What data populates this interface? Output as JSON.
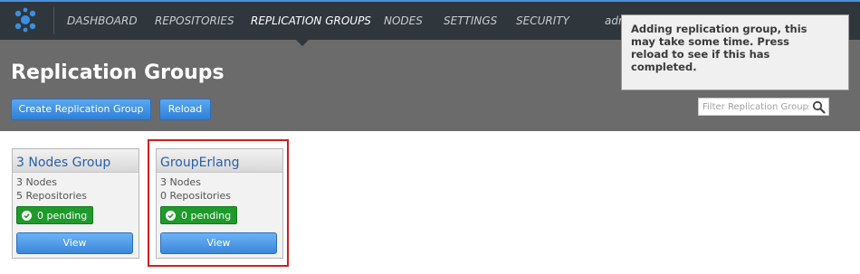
{
  "nav": {
    "items": [
      {
        "label": "DASHBOARD"
      },
      {
        "label": "REPOSITORIES"
      },
      {
        "label": "REPLICATION GROUPS"
      },
      {
        "label": "NODES"
      },
      {
        "label": "SETTINGS"
      },
      {
        "label": "SECURITY"
      }
    ],
    "user_partial": "adr",
    "logo_icon": "cluster-logo-icon"
  },
  "page": {
    "title": "Replication Groups"
  },
  "toolbar": {
    "create_label": "Create Replication Group",
    "reload_label": "Reload",
    "filter_placeholder": "Filter Replication Groups",
    "filter_icon": "magnifier-icon"
  },
  "tooltip": {
    "text": "Adding replication group, this\nmay take some time. Press\nreload to see if this has\ncompleted."
  },
  "groups": [
    {
      "name": "3 Nodes Group",
      "nodes": "3 Nodes",
      "repositories": "5 Repositories",
      "pending": "0 pending",
      "view_label": "View"
    },
    {
      "name": "GroupErlang",
      "nodes": "3 Nodes",
      "repositories": "0 Repositories",
      "pending": "0 pending",
      "view_label": "View"
    }
  ],
  "colors": {
    "accent": "#2f7fd8",
    "pending_green": "#1e9a2a",
    "highlight_red": "#d11f1f"
  }
}
